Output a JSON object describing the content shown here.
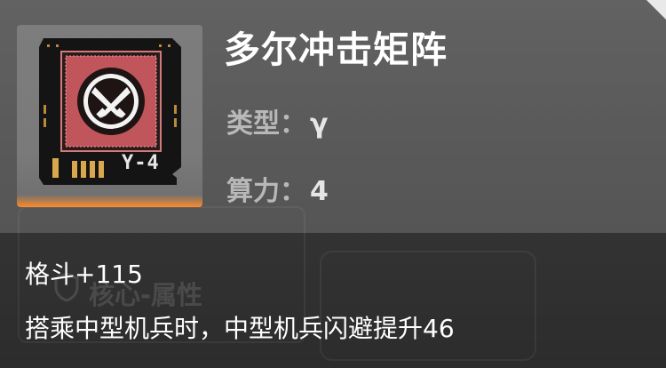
{
  "item": {
    "name": "多尔冲击矩阵",
    "chip_code": "Y-4",
    "type_label": "类型：",
    "type_value": "γ",
    "power_label": "算力：",
    "power_value": "4"
  },
  "effects": {
    "stat": "格斗+115",
    "description": "搭乘中型机兵时，中型机兵闪避提升46"
  },
  "background": {
    "ghost_label": "核心-属性"
  },
  "colors": {
    "glow": "#ff8a2a",
    "chip_red": "#c0565c",
    "panel_top": "#5e5e5e",
    "panel_bottom": "#2e2e2e"
  },
  "icons": {
    "chip_emblem": "crossed-knives-icon",
    "ghost_shield": "shield-icon"
  }
}
